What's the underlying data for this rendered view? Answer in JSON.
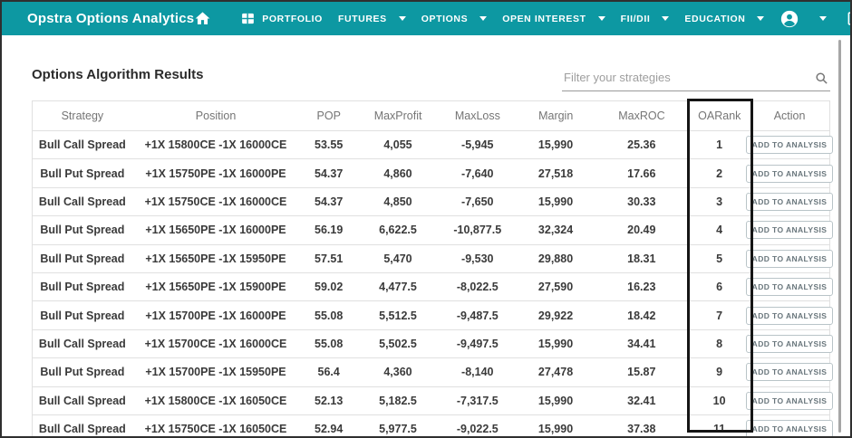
{
  "header": {
    "brand": "Opstra Options Analytics",
    "nav": [
      {
        "label": "PORTFOLIO",
        "icon": "grid-icon",
        "dropdown": false
      },
      {
        "label": "FUTURES",
        "dropdown": true
      },
      {
        "label": "OPTIONS",
        "dropdown": true
      },
      {
        "label": "OPEN INTEREST",
        "dropdown": true
      },
      {
        "label": "FII/DII",
        "dropdown": true
      },
      {
        "label": "EDUCATION",
        "dropdown": true
      }
    ],
    "icons": {
      "home": "home-icon",
      "account": "account-circle-icon",
      "account_dropdown": "chevron-down-icon",
      "logout": "logout-icon"
    }
  },
  "main": {
    "title": "Options Algorithm Results",
    "filter_placeholder": "Filter your strategies",
    "search_icon": "search-icon"
  },
  "table": {
    "columns": [
      "Strategy",
      "Position",
      "POP",
      "MaxProfit",
      "MaxLoss",
      "Margin",
      "MaxROC",
      "OARank",
      "Action"
    ],
    "action_label": "ADD TO ANALYSIS",
    "highlighted_column": "OARank",
    "rows": [
      {
        "strategy": "Bull Call Spread",
        "position": "+1X 15800CE -1X 16000CE",
        "pop": "53.55",
        "maxprofit": "4,055",
        "maxloss": "-5,945",
        "margin": "15,990",
        "maxroc": "25.36",
        "oarank": "1"
      },
      {
        "strategy": "Bull Put Spread",
        "position": "+1X 15750PE -1X 16000PE",
        "pop": "54.37",
        "maxprofit": "4,860",
        "maxloss": "-7,640",
        "margin": "27,518",
        "maxroc": "17.66",
        "oarank": "2"
      },
      {
        "strategy": "Bull Call Spread",
        "position": "+1X 15750CE -1X 16000CE",
        "pop": "54.37",
        "maxprofit": "4,850",
        "maxloss": "-7,650",
        "margin": "15,990",
        "maxroc": "30.33",
        "oarank": "3"
      },
      {
        "strategy": "Bull Put Spread",
        "position": "+1X 15650PE -1X 16000PE",
        "pop": "56.19",
        "maxprofit": "6,622.5",
        "maxloss": "-10,877.5",
        "margin": "32,324",
        "maxroc": "20.49",
        "oarank": "4"
      },
      {
        "strategy": "Bull Put Spread",
        "position": "+1X 15650PE -1X 15950PE",
        "pop": "57.51",
        "maxprofit": "5,470",
        "maxloss": "-9,530",
        "margin": "29,880",
        "maxroc": "18.31",
        "oarank": "5"
      },
      {
        "strategy": "Bull Put Spread",
        "position": "+1X 15650PE -1X 15900PE",
        "pop": "59.02",
        "maxprofit": "4,477.5",
        "maxloss": "-8,022.5",
        "margin": "27,590",
        "maxroc": "16.23",
        "oarank": "6"
      },
      {
        "strategy": "Bull Put Spread",
        "position": "+1X 15700PE -1X 16000PE",
        "pop": "55.08",
        "maxprofit": "5,512.5",
        "maxloss": "-9,487.5",
        "margin": "29,922",
        "maxroc": "18.42",
        "oarank": "7"
      },
      {
        "strategy": "Bull Call Spread",
        "position": "+1X 15700CE -1X 16000CE",
        "pop": "55.08",
        "maxprofit": "5,502.5",
        "maxloss": "-9,497.5",
        "margin": "15,990",
        "maxroc": "34.41",
        "oarank": "8"
      },
      {
        "strategy": "Bull Put Spread",
        "position": "+1X 15700PE -1X 15950PE",
        "pop": "56.4",
        "maxprofit": "4,360",
        "maxloss": "-8,140",
        "margin": "27,478",
        "maxroc": "15.87",
        "oarank": "9"
      },
      {
        "strategy": "Bull Call Spread",
        "position": "+1X 15800CE -1X 16050CE",
        "pop": "52.13",
        "maxprofit": "5,182.5",
        "maxloss": "-7,317.5",
        "margin": "15,990",
        "maxroc": "32.41",
        "oarank": "10"
      },
      {
        "strategy": "Bull Call Spread",
        "position": "+1X 15750CE -1X 16050CE",
        "pop": "52.94",
        "maxprofit": "5,977.5",
        "maxloss": "-9,022.5",
        "margin": "15,990",
        "maxroc": "37.38",
        "oarank": "11"
      }
    ]
  },
  "colors": {
    "brand_teal": "#0D98A2",
    "positive_green": "#4CAF50",
    "negative_red": "#EF5350",
    "annotation_black": "#151515"
  }
}
